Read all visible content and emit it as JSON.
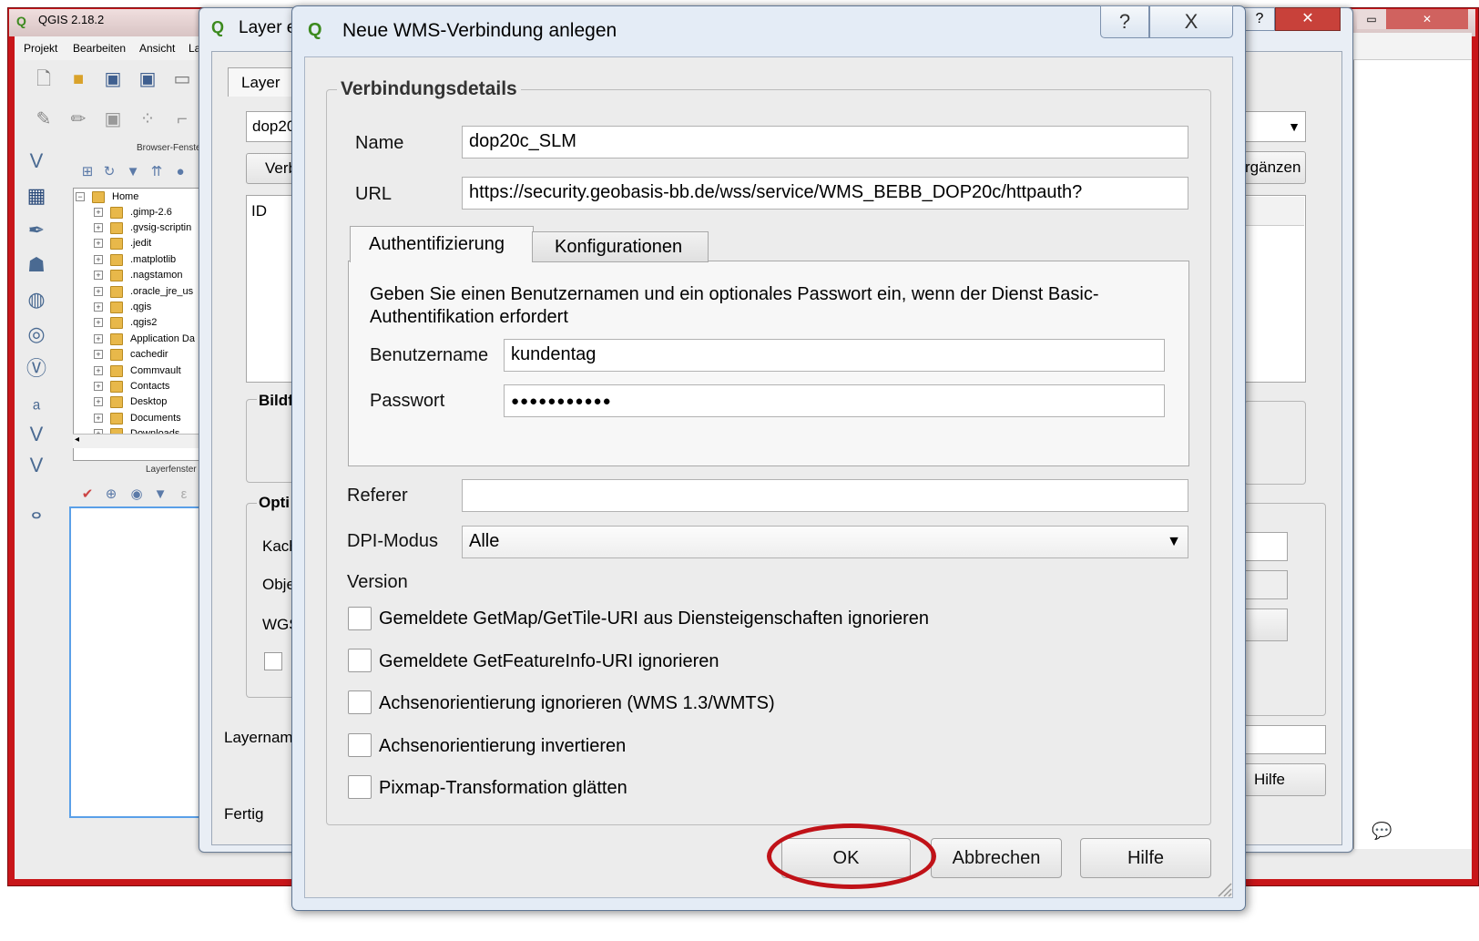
{
  "qgis": {
    "title": "QGIS 2.18.2",
    "menu": [
      "Projekt",
      "Bearbeiten",
      "Ansicht",
      "La"
    ],
    "browser_panel_title": "Browser-Fenste",
    "layer_panel_title": "Layerfenster",
    "tree": [
      {
        "label": "Home",
        "root": true
      },
      {
        "label": ".gimp-2.6"
      },
      {
        "label": ".gvsig-scriptin"
      },
      {
        "label": ".jedit"
      },
      {
        "label": ".matplotlib"
      },
      {
        "label": ".nagstamon"
      },
      {
        "label": ".oracle_jre_us"
      },
      {
        "label": ".qgis"
      },
      {
        "label": ".qgis2"
      },
      {
        "label": "Application Da"
      },
      {
        "label": "cachedir"
      },
      {
        "label": "Commvault"
      },
      {
        "label": "Contacts"
      },
      {
        "label": "Desktop"
      },
      {
        "label": "Documents"
      },
      {
        "label": "Downloads"
      }
    ]
  },
  "layer_dialog": {
    "title": "Layer e",
    "tab_label": "Layer",
    "combo_value": "dop20",
    "connect_button": "Verb",
    "table_header": "ID",
    "group1_label": "Bildf",
    "group2_label": "Opti",
    "labels": [
      "Kach",
      "Obje",
      "WGS"
    ],
    "layername_label": "Layernam",
    "status": "Fertig",
    "add_button": "rgänzen",
    "help_button": "Hilfe"
  },
  "wms_dialog": {
    "title": "Neue WMS-Verbindung anlegen",
    "help_icon": "?",
    "close_icon": "X",
    "group_label": "Verbindungsdetails",
    "name_label": "Name",
    "name_value": "dop20c_SLM",
    "url_label": "URL",
    "url_value": "https://security.geobasis-bb.de/wss/service/WMS_BEBB_DOP20c/httpauth?",
    "tabs": [
      "Authentifizierung",
      "Konfigurationen"
    ],
    "auth_description_line1": "Geben Sie einen Benutzernamen und ein optionales Passwort ein, wenn der Dienst Basic-",
    "auth_description_line2": "Authentifikation erfordert",
    "username_label": "Benutzername",
    "username_value": "kundentag",
    "password_label": "Passwort",
    "password_value": "●●●●●●●●●●●",
    "referer_label": "Referer",
    "referer_value": "",
    "dpi_label": "DPI-Modus",
    "dpi_value": "Alle",
    "version_label": "Version",
    "checkboxes": [
      {
        "label": "Gemeldete GetMap/GetTile-URI aus Diensteigenschaften ignorieren",
        "checked": false
      },
      {
        "label": "Gemeldete GetFeatureInfo-URI ignorieren",
        "checked": false
      },
      {
        "label": "Achsenorientierung ignorieren (WMS 1.3/WMTS)",
        "checked": false
      },
      {
        "label": "Achsenorientierung invertieren",
        "checked": false
      },
      {
        "label": "Pixmap-Transformation glätten",
        "checked": false
      }
    ],
    "buttons": {
      "ok": "OK",
      "cancel": "Abbrechen",
      "help": "Hilfe"
    },
    "highlight_color": "#c01218"
  }
}
